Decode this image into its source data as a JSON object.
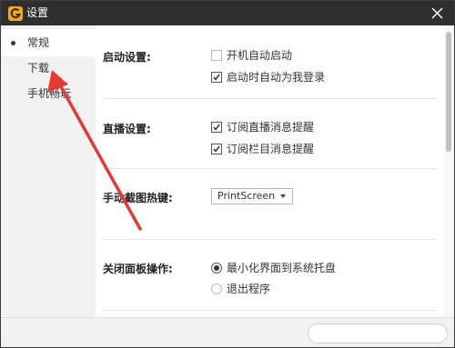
{
  "window": {
    "title": "设置",
    "accent_color": "#f5a623",
    "titlebar_color": "#2f2f2f"
  },
  "sidebar": {
    "items": [
      {
        "label": "常规",
        "active": true
      },
      {
        "label": "下载",
        "active": false
      },
      {
        "label": "手机畅玩",
        "active": false
      }
    ]
  },
  "sections": {
    "startup": {
      "title": "启动设置:",
      "options": [
        {
          "label": "开机自动启动",
          "checked": false
        },
        {
          "label": "启动时自动为我登录",
          "checked": true
        }
      ]
    },
    "live": {
      "title": "直播设置:",
      "options": [
        {
          "label": "订阅直播消息提醒",
          "checked": true
        },
        {
          "label": "订阅栏目消息提醒",
          "checked": true
        }
      ]
    },
    "screenshot": {
      "title": "手动截图热键:",
      "selected": "PrintScreen"
    },
    "close_panel": {
      "title": "关闭面板操作:",
      "options": [
        {
          "label": "最小化界面到系统托盘",
          "selected": true
        },
        {
          "label": "退出程序",
          "selected": false
        }
      ]
    }
  },
  "annotation": {
    "color": "#e53935"
  }
}
